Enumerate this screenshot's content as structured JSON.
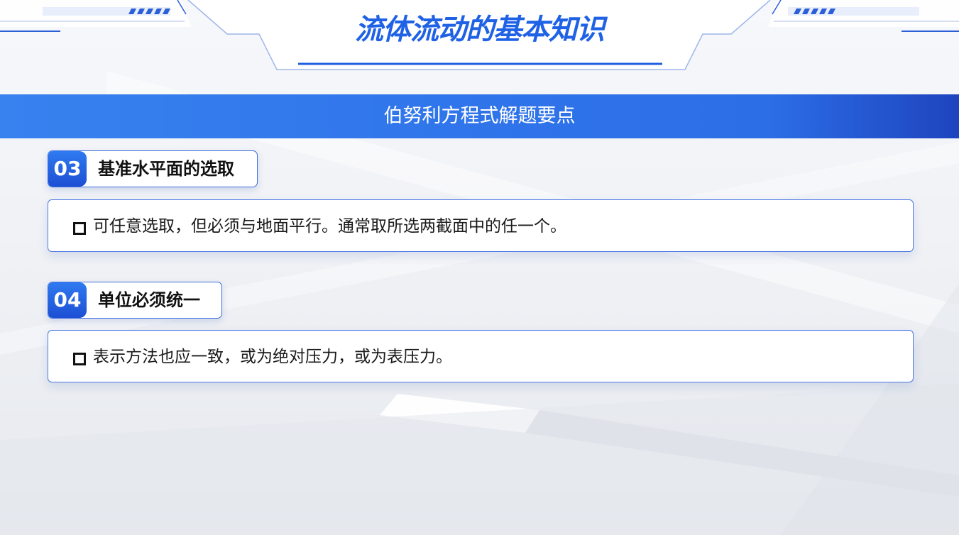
{
  "header": {
    "title": "流体流动的基本知识"
  },
  "banner": {
    "text": "伯努利方程式解题要点"
  },
  "sections": [
    {
      "number": "03",
      "heading": "基准水平面的选取",
      "text": "可任意选取，但必须与地面平行。通常取所选两截面中的任一个。"
    },
    {
      "number": "04",
      "heading": "单位必须统一",
      "text": "表示方法也应一致，或为绝对压力，或为表压力。"
    }
  ],
  "colors": {
    "accent": "#1f62e6",
    "banner_start": "#3782ef",
    "banner_end": "#1e44bf",
    "border": "#4c7ae3"
  }
}
